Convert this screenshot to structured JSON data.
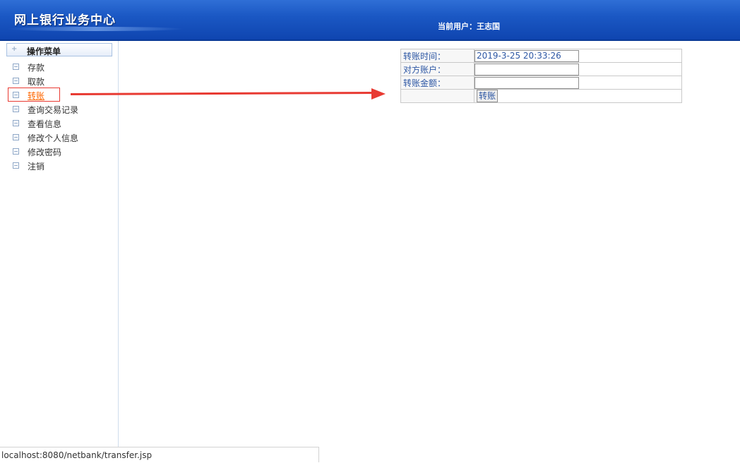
{
  "header": {
    "title": "网上银行业务中心",
    "current_user": "当前用户：王志国"
  },
  "sidebar": {
    "menu_title": "操作菜单",
    "items": [
      {
        "label": "存款"
      },
      {
        "label": "取款"
      },
      {
        "label": "转账",
        "active": true
      },
      {
        "label": "查询交易记录"
      },
      {
        "label": "查看信息"
      },
      {
        "label": "修改个人信息"
      },
      {
        "label": "修改密码"
      },
      {
        "label": "注销"
      }
    ]
  },
  "transfer_form": {
    "time_label": "转账时间：",
    "time_value": "2019-3-25 20:33:26",
    "account_label": "对方账户：",
    "account_value": "",
    "amount_label": "转账金额：",
    "amount_value": "",
    "submit_label": "转账"
  },
  "status_bar": {
    "url": "localhost:8080/netbank/transfer.jsp"
  },
  "colors": {
    "header_blue": "#1b58c4",
    "link_active": "#ff6600",
    "annotation_red": "#e83a32",
    "label_blue": "#2d57a4"
  }
}
